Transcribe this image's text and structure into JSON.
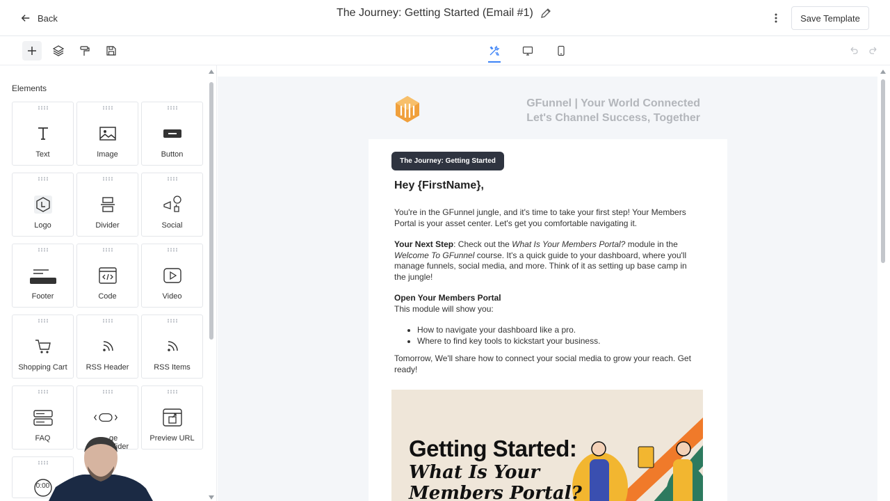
{
  "header": {
    "back_label": "Back",
    "title": "The Journey: Getting Started (Email #1)",
    "save_label": "Save Template"
  },
  "toolbar": {
    "left_tools": [
      "plus-icon",
      "layers-icon",
      "paint-roller-icon",
      "save-icon"
    ],
    "view_tools": [
      "tools-icon",
      "desktop-icon",
      "mobile-icon"
    ],
    "active_view": "tools-icon",
    "history_tools": [
      "undo-icon",
      "redo-icon"
    ]
  },
  "sidebar": {
    "heading": "Elements",
    "items": [
      {
        "label": "Text",
        "icon": "text-icon"
      },
      {
        "label": "Image",
        "icon": "image-icon"
      },
      {
        "label": "Button",
        "icon": "button-icon"
      },
      {
        "label": "Logo",
        "icon": "logo-icon"
      },
      {
        "label": "Divider",
        "icon": "divider-icon"
      },
      {
        "label": "Social",
        "icon": "social-icon"
      },
      {
        "label": "Footer",
        "icon": "footer-icon"
      },
      {
        "label": "Code",
        "icon": "code-icon"
      },
      {
        "label": "Video",
        "icon": "video-icon"
      },
      {
        "label": "Shopping Cart",
        "icon": "cart-icon"
      },
      {
        "label": "RSS Header",
        "icon": "rss-icon"
      },
      {
        "label": "RSS Items",
        "icon": "rss-icon"
      },
      {
        "label": "FAQ",
        "icon": "faq-icon"
      },
      {
        "label": "ge Slider",
        "icon": "slider-icon"
      },
      {
        "label": "Preview URL",
        "icon": "preview-url-icon"
      },
      {
        "label": "",
        "icon": "timer-icon",
        "timer_text": "0:00"
      }
    ]
  },
  "email": {
    "brand_line1": "GFunnel | Your World Connected",
    "brand_line2": "Let's Channel Success, Together",
    "badge": "The Journey: Getting Started",
    "greeting": "Hey {FirstName},",
    "intro": "You're in the GFunnel jungle, and it's time to take your first step! Your Members Portal is your asset center. Let's get you comfortable navigating it.",
    "next_step_label": "Your Next Step",
    "next_step_a": ": Check out the ",
    "next_step_module": "What Is Your Members Portal?",
    "next_step_b": " module in the ",
    "next_step_course": "Welcome To GFunnel",
    "next_step_c": " course. It's a quick guide to your dashboard, where you'll manage funnels, social media, and more. Think of it as setting up base camp in the jungle!",
    "open_portal_heading": "Open Your Members Portal",
    "open_portal_text": "This module will show you:",
    "bullets": [
      "How to navigate your dashboard like a pro.",
      "Where to find key tools to kickstart your business."
    ],
    "tomorrow": "Tomorrow, We'll share how to connect your social media to grow your reach. Get ready!",
    "hero_title": "Getting Started:",
    "hero_sub1": "What Is Your",
    "hero_sub2": "Members Portal?"
  },
  "colors": {
    "badge_bg": "#2f3440",
    "accent": "#3b82f6",
    "brand_gray": "#b3b6bb",
    "hero_bg": "#efe6d9",
    "logo_orange": "#f0a03c"
  }
}
